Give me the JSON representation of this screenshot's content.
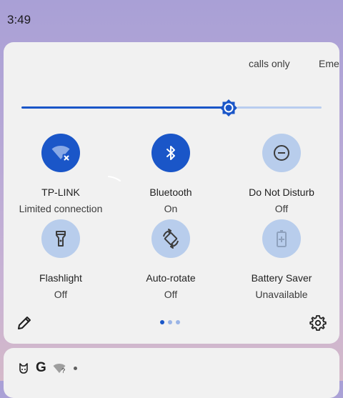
{
  "status_bar": {
    "time": "3:49"
  },
  "quick_settings": {
    "dnd_chips": [
      "calls only",
      "Eme"
    ],
    "brightness": {
      "level_percent": 69
    },
    "tiles": [
      {
        "label": "TP-LINK",
        "sub": "Limited connection",
        "state": "on",
        "icon": "wifi-limited-icon"
      },
      {
        "label": "Bluetooth",
        "sub": "On",
        "state": "on",
        "icon": "bluetooth-icon"
      },
      {
        "label": "Do Not Disturb",
        "sub": "Off",
        "state": "off",
        "icon": "do-not-disturb-icon"
      },
      {
        "label": "Flashlight",
        "sub": "Off",
        "state": "off",
        "icon": "flashlight-icon"
      },
      {
        "label": "Auto-rotate",
        "sub": "Off",
        "state": "off",
        "icon": "auto-rotate-icon"
      },
      {
        "label": "Battery Saver",
        "sub": "Unavailable",
        "state": "off",
        "icon": "battery-saver-icon"
      }
    ],
    "pages": {
      "count": 3,
      "current": 1
    },
    "footer": {
      "edit_icon": "pencil-icon",
      "settings_icon": "gear-icon"
    }
  },
  "notification_strip": {
    "icons": [
      "cat-face-icon",
      "google-g-icon",
      "wifi-question-icon",
      "more-dot-icon"
    ],
    "google_letter": "G"
  },
  "colors": {
    "accent": "#1a56c8",
    "tile_off": "#b8cdec",
    "panel": "#f1f1f1"
  }
}
